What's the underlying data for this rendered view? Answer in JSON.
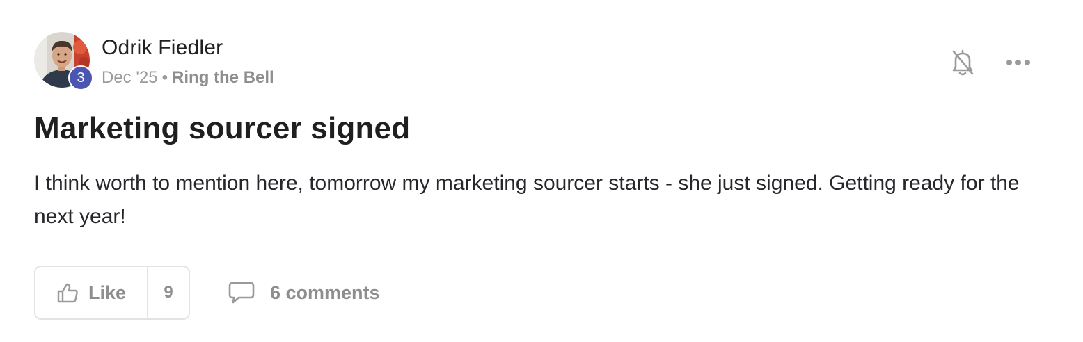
{
  "author": {
    "name": "Odrik Fiedler",
    "level_badge": "3",
    "avatar_icon": "user-avatar-photo"
  },
  "meta": {
    "date": "Dec '25",
    "separator": "•",
    "category": "Ring the Bell"
  },
  "post": {
    "title": "Marketing sourcer signed",
    "body": "I think worth to mention here, tomorrow my marketing sourcer starts - she just signed. Getting ready for the next year!"
  },
  "actions": {
    "notifications_icon": "bell-off-icon",
    "more_icon": "more-horizontal-icon",
    "like_label": "Like",
    "like_count": "9",
    "comments_label": "6 comments"
  },
  "colors": {
    "badge": "#4a56b0",
    "muted_text": "#8e8e8e",
    "border": "#e3e3e3"
  }
}
